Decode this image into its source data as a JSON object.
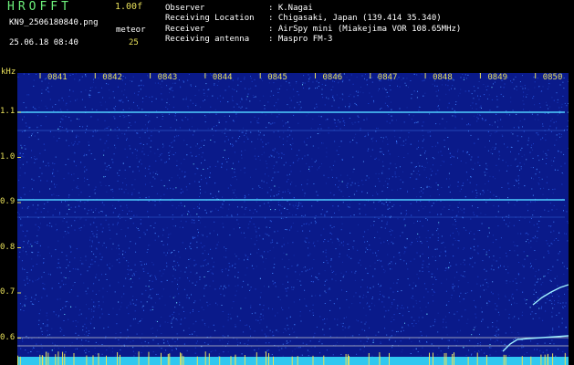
{
  "header": {
    "title": "HROFFT",
    "version": "1.00f",
    "filename": "KN9_2506180840.png",
    "mode": "meteor",
    "datetime": "25.06.18 08:40",
    "level": "25",
    "observer_label": "Observer",
    "observer": "K.Nagai",
    "location_label": "Receiving Location",
    "location": "Chigasaki, Japan (139.414 35.340)",
    "receiver_label": "Receiver",
    "receiver": "AirSpy mini (Miakejima VOR 108.65MHz)",
    "antenna_label": "Receiving antenna",
    "antenna": "Maspro FM-3"
  },
  "axis": {
    "unit": "kHz",
    "y_ticks": [
      "1.1",
      "1.0",
      "0.9",
      "0.8",
      "0.7",
      "0.6"
    ],
    "x_ticks": [
      "0841",
      "0842",
      "0843",
      "0844",
      "0845",
      "0846",
      "0847",
      "0848",
      "0849",
      "0850"
    ]
  },
  "colors": {
    "background": "#0a1a8a",
    "trace": "#4fd0ff",
    "bottom_band": "#2fc8f0",
    "marker_line": "#c8c8c8",
    "tick_yellow": "#e8e05a"
  }
}
